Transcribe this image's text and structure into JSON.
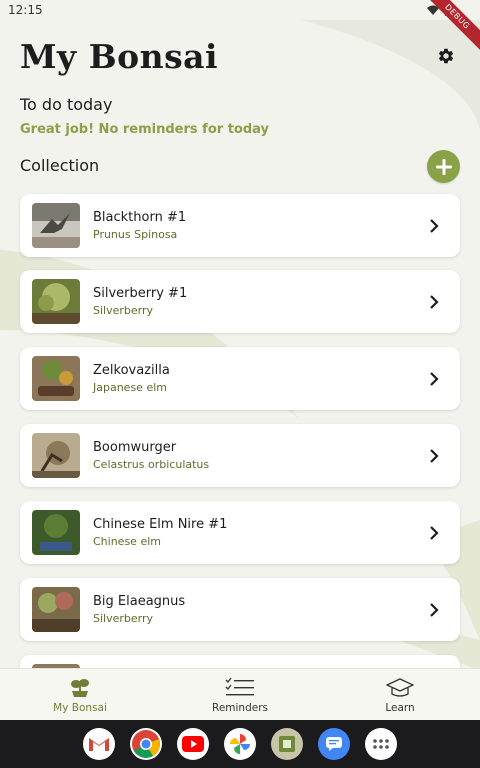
{
  "status_bar": {
    "time": "12:15",
    "debug_label": "DEBUG"
  },
  "header": {
    "title": "My Bonsai",
    "settings_icon": "gear-icon"
  },
  "todo": {
    "heading": "To do today",
    "message": "Great job! No reminders for today"
  },
  "collection": {
    "heading": "Collection",
    "items": [
      {
        "name": "Blackthorn #1",
        "species": "Prunus Spinosa"
      },
      {
        "name": "Silverberry #1",
        "species": "Silverberry"
      },
      {
        "name": "Zelkovazilla",
        "species": "Japanese elm"
      },
      {
        "name": "Boomwurger",
        "species": "Celastrus orbiculatus"
      },
      {
        "name": "Chinese Elm Nire #1",
        "species": "Chinese elm"
      },
      {
        "name": "Big Elaeagnus",
        "species": "Silverberry"
      }
    ]
  },
  "bottom_nav": {
    "items": [
      {
        "label": "My Bonsai",
        "icon": "bonsai-icon",
        "active": true
      },
      {
        "label": "Reminders",
        "icon": "checklist-icon",
        "active": false
      },
      {
        "label": "Learn",
        "icon": "graduation-cap-icon",
        "active": false
      }
    ]
  },
  "dock": {
    "apps": [
      "gmail-icon",
      "chrome-icon",
      "youtube-icon",
      "photos-icon",
      "sheets-icon",
      "messages-icon",
      "app-drawer-icon"
    ]
  },
  "colors": {
    "accent": "#8aa147",
    "background": "#f3f3ee",
    "subtitle": "#5d6d2a"
  }
}
